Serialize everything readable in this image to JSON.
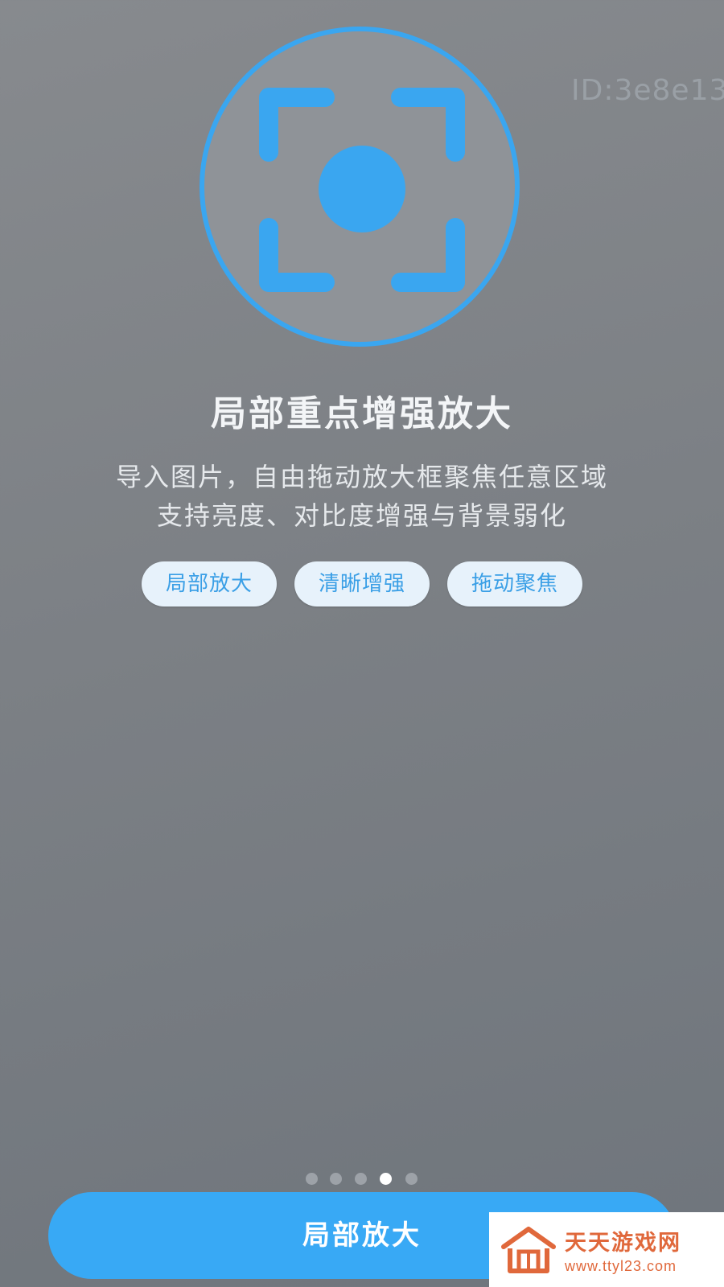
{
  "overlay": {
    "id_label": "ID:3e8e13"
  },
  "hero": {
    "icon": "focus-frame-icon",
    "accent_color": "#3aa6f0"
  },
  "feature": {
    "title": "局部重点增强放大",
    "description_lines": [
      "导入图片，自由拖动放大框聚焦任意区域",
      "支持亮度、对比度增强与背景弱化"
    ],
    "tags": [
      "局部放大",
      "清晰增强",
      "拖动聚焦"
    ]
  },
  "pager": {
    "total": 5,
    "current": 4
  },
  "primary_button": {
    "label": "局部放大",
    "color": "#38a9f5"
  },
  "watermark": {
    "title": "天天游戏网",
    "url": "www.ttyl23.com",
    "logo": "house-logo-icon"
  }
}
